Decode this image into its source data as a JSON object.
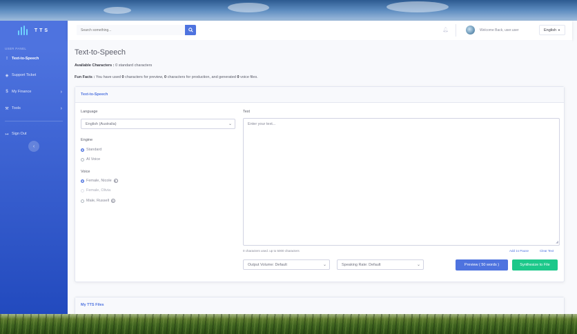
{
  "sidebar": {
    "brand": "TTS",
    "heading": "USER PANEL",
    "items": [
      {
        "label": "Text-to-Speech",
        "icon": "waveform-icon"
      },
      {
        "label": "Support Ticket",
        "icon": "tag-icon"
      },
      {
        "label": "My Finance",
        "icon": "dollar-icon"
      },
      {
        "label": "Tools",
        "icon": "wrench-icon"
      },
      {
        "label": "Sign Out",
        "icon": "sign-out-icon"
      }
    ]
  },
  "topbar": {
    "search_placeholder": "Search something...",
    "welcome": "Welcome Back, user.user",
    "language": "English"
  },
  "page": {
    "title": "Text-to-Speech",
    "available_label": "Available Characters :",
    "available_value": "0 standard characters",
    "fun_label": "Fun Facts :",
    "fun_1": "You have used",
    "fun_n1": "0",
    "fun_2": "characters for preview,",
    "fun_n2": "0",
    "fun_3": "characters for production, and generated",
    "fun_n3": "0",
    "fun_4": "voice files."
  },
  "form": {
    "card_title": "Text-to-Speech",
    "language_label": "Language",
    "language_value": "English (Australia)",
    "engine_label": "Engine",
    "engines": [
      "Standard",
      "AI Voice"
    ],
    "voice_label": "Voice",
    "voices": [
      "Female, Nicole",
      "Female, Olivia",
      "Male, Russell"
    ],
    "text_label": "Text",
    "text_placeholder": "Enter your text...",
    "char_count": "0 characters used. up to 5000 characters",
    "add_pause": "Add 1s Pause",
    "clear_text": "Clear Text",
    "volume": "Output Volume: Default",
    "rate": "Speaking Rate: Default",
    "preview_button": "Preview ( 50 words )",
    "synthesize_button": "Synthesize to File"
  },
  "files": {
    "title": "My TTS Files"
  },
  "colors": {
    "primary": "#4e73df",
    "success": "#1cc88a"
  }
}
